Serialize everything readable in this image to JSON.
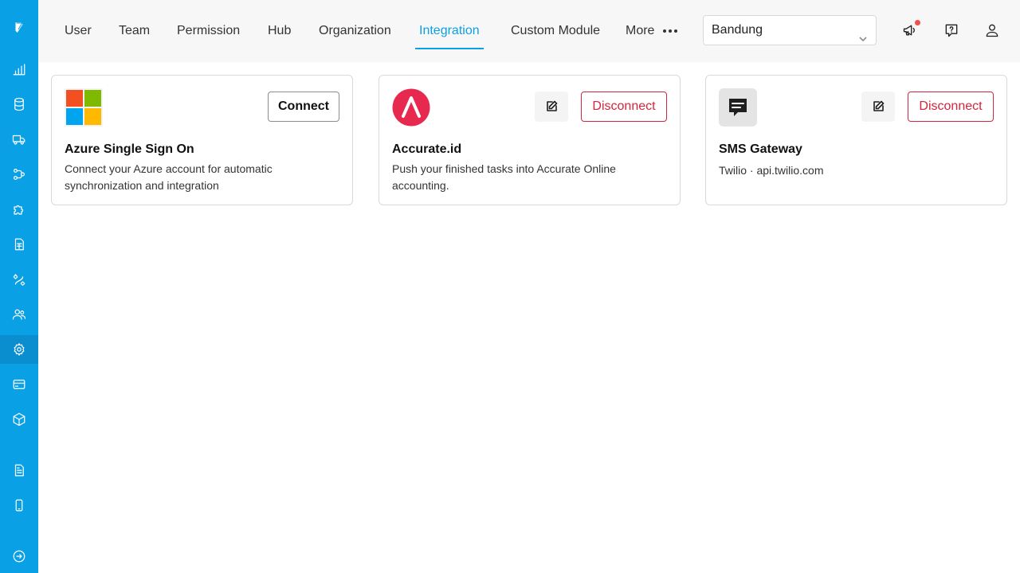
{
  "colors": {
    "brand": "#0aa0e6",
    "danger": "#d4243e",
    "notification": "#f0504a"
  },
  "sidebar": {
    "items": [
      {
        "icon": "logo-icon"
      },
      {
        "icon": "analytics-icon"
      },
      {
        "icon": "database-icon"
      },
      {
        "icon": "truck-icon"
      },
      {
        "icon": "workflow-icon"
      },
      {
        "icon": "puzzle-icon"
      },
      {
        "icon": "spreadsheet-icon"
      },
      {
        "icon": "routes-icon"
      },
      {
        "icon": "users-icon"
      },
      {
        "icon": "gear-icon",
        "active": true
      },
      {
        "icon": "credit-card-icon"
      },
      {
        "icon": "package-icon"
      },
      {
        "icon": "document-icon"
      },
      {
        "icon": "mobile-icon"
      },
      {
        "icon": "expand-icon"
      }
    ]
  },
  "nav": {
    "tabs": [
      {
        "label": "User"
      },
      {
        "label": "Team"
      },
      {
        "label": "Permission"
      },
      {
        "label": "Hub"
      },
      {
        "label": "Organization"
      },
      {
        "label": "Integration",
        "active": true
      },
      {
        "label": "Custom Module"
      },
      {
        "label": "More"
      }
    ]
  },
  "location": {
    "selected": "Bandung"
  },
  "header_icons": [
    "megaphone-icon",
    "help-icon",
    "user-icon"
  ],
  "integrations": [
    {
      "name": "Azure Single Sign On",
      "description": "Connect your Azure account for automatic synchronization and integration",
      "action": "Connect",
      "logo": "microsoft-logo"
    },
    {
      "name": "Accurate.id",
      "description": "Push your finished tasks into Accurate Online accounting.",
      "action": "Disconnect",
      "logo": "accurate-logo"
    },
    {
      "name": "SMS Gateway",
      "subtitle": "Twilio · api.twilio.com",
      "action": "Disconnect",
      "logo": "sms-icon"
    }
  ]
}
